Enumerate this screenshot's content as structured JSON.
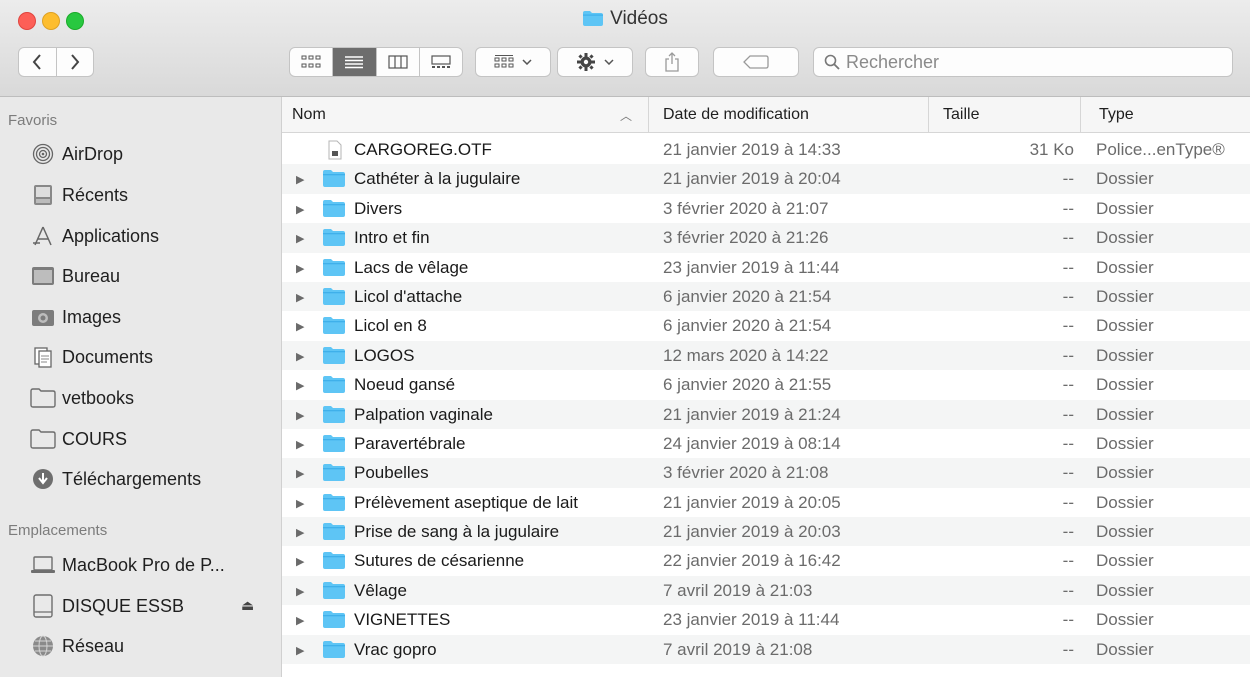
{
  "window": {
    "title": "Vidéos"
  },
  "toolbar": {
    "search_placeholder": "Rechercher"
  },
  "sidebar": {
    "favorites_heading": "Favoris",
    "favorites": [
      {
        "label": "AirDrop",
        "icon": "airdrop-icon"
      },
      {
        "label": "Récents",
        "icon": "recents-icon"
      },
      {
        "label": "Applications",
        "icon": "applications-icon"
      },
      {
        "label": "Bureau",
        "icon": "desktop-icon"
      },
      {
        "label": "Images",
        "icon": "camera-icon"
      },
      {
        "label": "Documents",
        "icon": "documents-icon"
      },
      {
        "label": "vetbooks",
        "icon": "folder-icon"
      },
      {
        "label": "COURS",
        "icon": "folder-icon"
      },
      {
        "label": "Téléchargements",
        "icon": "download-icon"
      }
    ],
    "locations_heading": "Emplacements",
    "locations": [
      {
        "label": "MacBook Pro de P...",
        "icon": "laptop-icon"
      },
      {
        "label": "DISQUE ESSB",
        "icon": "drive-icon",
        "eject": "⏏"
      },
      {
        "label": "Réseau",
        "icon": "network-icon"
      }
    ]
  },
  "columns": {
    "name": "Nom",
    "date": "Date de modification",
    "size": "Taille",
    "type": "Type"
  },
  "files": [
    {
      "name": "CARGOREG.OTF",
      "date": "21 janvier 2019 à 14:33",
      "size": "31 Ko",
      "type": "Police...enType®",
      "kind": "file"
    },
    {
      "name": "Cathéter à la jugulaire",
      "date": "21 janvier 2019 à 20:04",
      "size": "--",
      "type": "Dossier",
      "kind": "folder"
    },
    {
      "name": "Divers",
      "date": "3 février 2020 à 21:07",
      "size": "--",
      "type": "Dossier",
      "kind": "folder"
    },
    {
      "name": "Intro et fin",
      "date": "3 février 2020 à 21:26",
      "size": "--",
      "type": "Dossier",
      "kind": "folder"
    },
    {
      "name": "Lacs de vêlage",
      "date": "23 janvier 2019 à 11:44",
      "size": "--",
      "type": "Dossier",
      "kind": "folder"
    },
    {
      "name": "Licol d'attache",
      "date": "6 janvier 2020 à 21:54",
      "size": "--",
      "type": "Dossier",
      "kind": "folder"
    },
    {
      "name": "Licol en 8",
      "date": "6 janvier 2020 à 21:54",
      "size": "--",
      "type": "Dossier",
      "kind": "folder"
    },
    {
      "name": "LOGOS",
      "date": "12 mars 2020 à 14:22",
      "size": "--",
      "type": "Dossier",
      "kind": "folder"
    },
    {
      "name": "Noeud gansé",
      "date": "6 janvier 2020 à 21:55",
      "size": "--",
      "type": "Dossier",
      "kind": "folder"
    },
    {
      "name": "Palpation vaginale",
      "date": "21 janvier 2019 à 21:24",
      "size": "--",
      "type": "Dossier",
      "kind": "folder"
    },
    {
      "name": "Paravertébrale",
      "date": "24 janvier 2019 à 08:14",
      "size": "--",
      "type": "Dossier",
      "kind": "folder"
    },
    {
      "name": "Poubelles",
      "date": "3 février 2020 à 21:08",
      "size": "--",
      "type": "Dossier",
      "kind": "folder"
    },
    {
      "name": "Prélèvement aseptique de lait",
      "date": "21 janvier 2019 à 20:05",
      "size": "--",
      "type": "Dossier",
      "kind": "folder"
    },
    {
      "name": "Prise de sang à la jugulaire",
      "date": "21 janvier 2019 à 20:03",
      "size": "--",
      "type": "Dossier",
      "kind": "folder"
    },
    {
      "name": "Sutures de césarienne",
      "date": "22 janvier 2019 à 16:42",
      "size": "--",
      "type": "Dossier",
      "kind": "folder"
    },
    {
      "name": "Vêlage",
      "date": "7 avril 2019 à 21:03",
      "size": "--",
      "type": "Dossier",
      "kind": "folder"
    },
    {
      "name": "VIGNETTES",
      "date": "23 janvier 2019 à 11:44",
      "size": "--",
      "type": "Dossier",
      "kind": "folder"
    },
    {
      "name": "Vrac gopro",
      "date": "7 avril 2019 à 21:08",
      "size": "--",
      "type": "Dossier",
      "kind": "folder"
    }
  ],
  "colors": {
    "folder": "#5ec5f5",
    "folder_tab": "#3fb0ea",
    "row_alt": "#f4f5f5",
    "sidebar": "#e9e9e9"
  }
}
